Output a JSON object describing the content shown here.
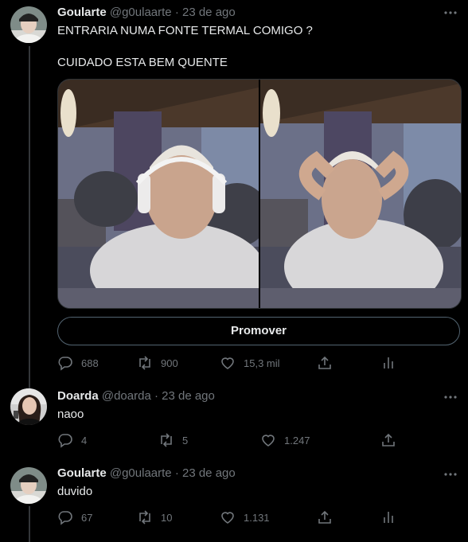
{
  "tweets": [
    {
      "name": "Goularte",
      "handle": "@g0ulaarte",
      "separator": "·",
      "date": "23 de ago",
      "lines": [
        "ENTRARIA NUMA FONTE TERMAL COMIGO ?",
        "CUIDADO ESTA BEM QUENTE"
      ],
      "promote_label": "Promover",
      "replies": "688",
      "retweets": "900",
      "likes": "15,3 mil"
    },
    {
      "name": "Doarda",
      "handle": "@doarda",
      "separator": "·",
      "date": "23 de ago",
      "text": "naoo",
      "replies": "4",
      "retweets": "5",
      "likes": "1.247"
    },
    {
      "name": "Goularte",
      "handle": "@g0ulaarte",
      "separator": "·",
      "date": "23 de ago",
      "text": "duvido",
      "replies": "67",
      "retweets": "10",
      "likes": "1.131"
    }
  ],
  "icons": {
    "reply": "reply-icon",
    "retweet": "retweet-icon",
    "like": "like-icon",
    "share": "share-icon",
    "analytics": "analytics-icon",
    "more": "more-icon"
  },
  "colors": {
    "background": "#000000",
    "text_primary": "#e7e9ea",
    "text_secondary": "#71767b",
    "divider": "#2f3336"
  }
}
